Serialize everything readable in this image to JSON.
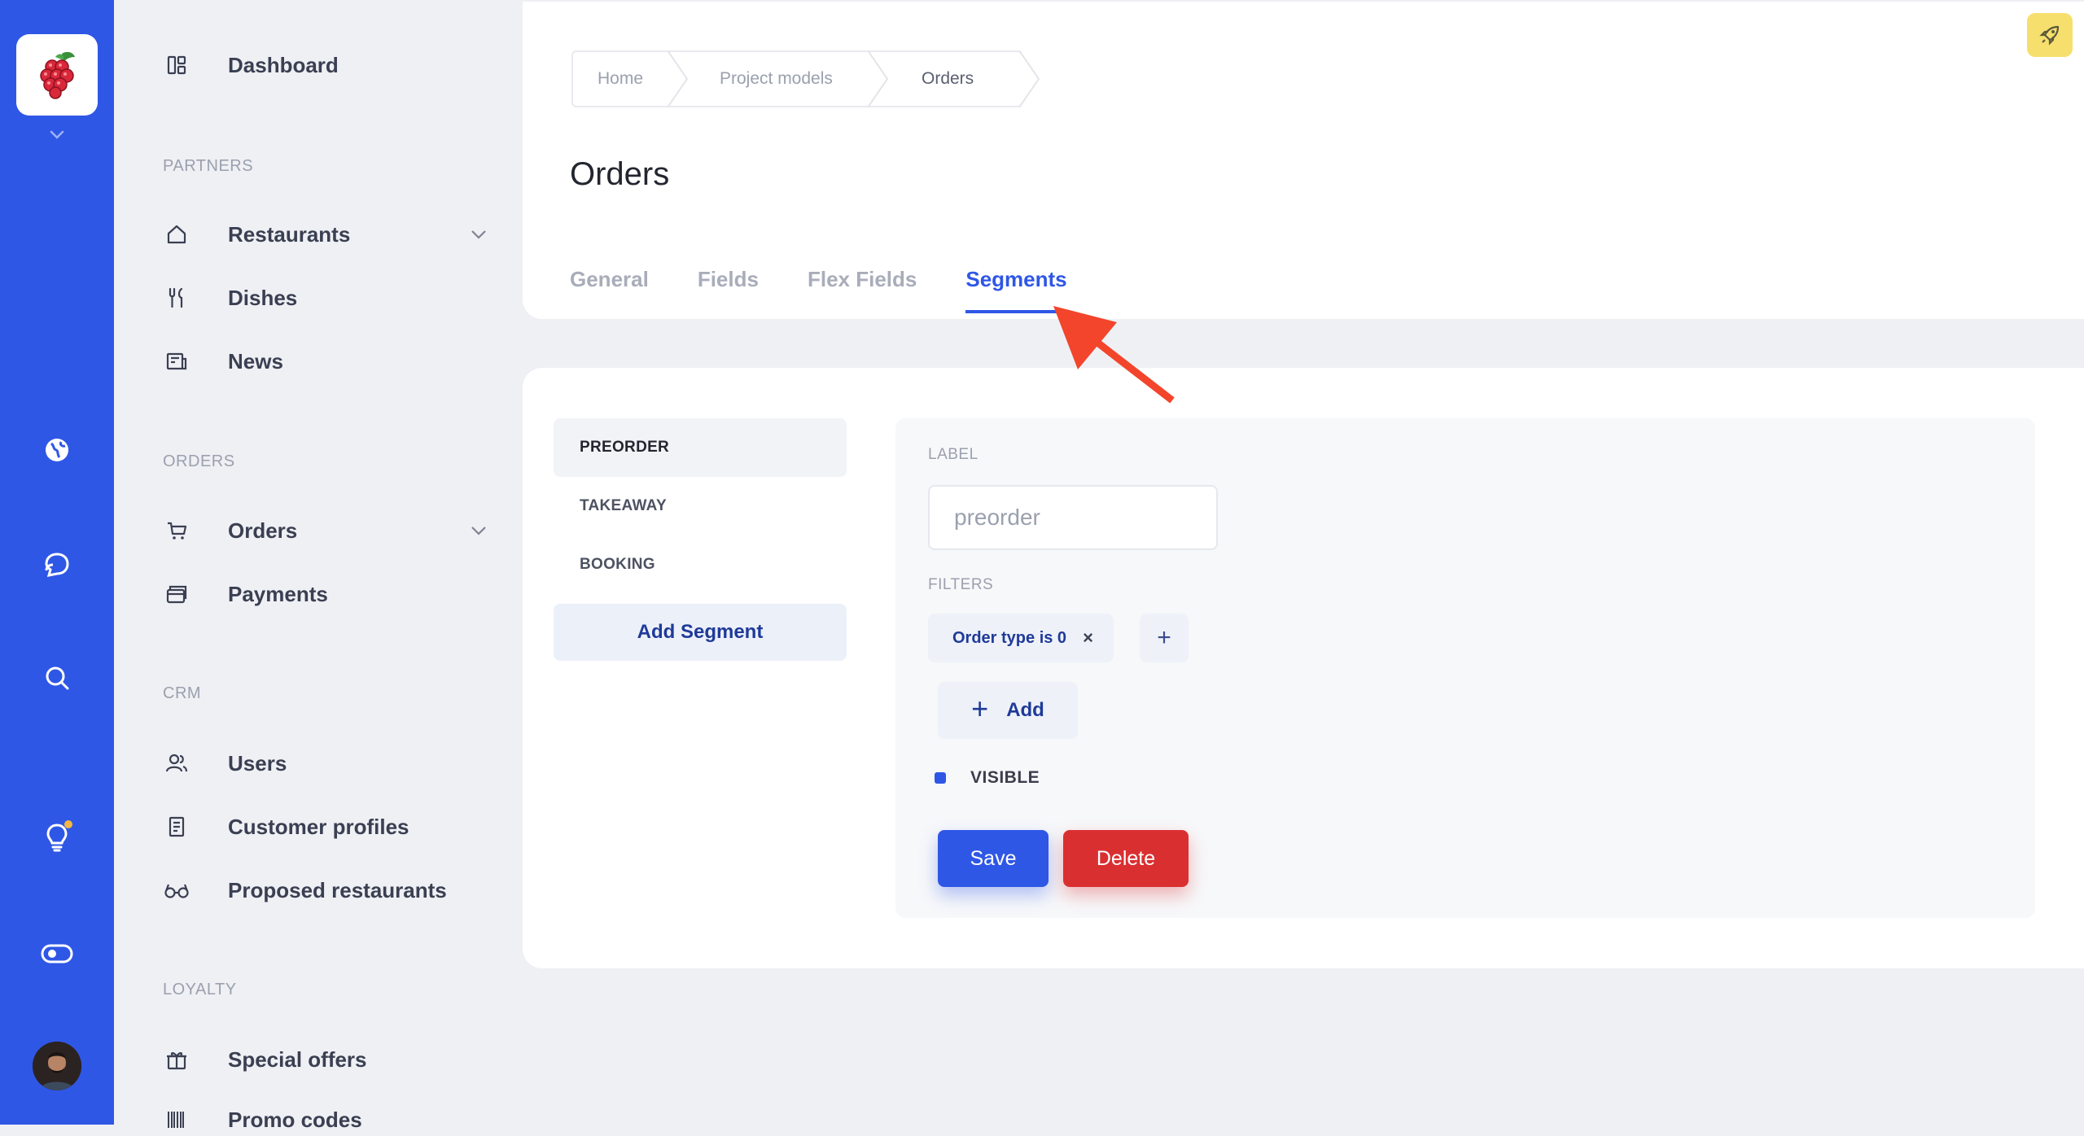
{
  "colors": {
    "accent": "#2f57e6",
    "danger": "#da2f31",
    "rail": "#2f57e6",
    "annotation_arrow": "#f2452c"
  },
  "rail": {
    "icons": [
      "app-logo-icon",
      "chevron-down-icon",
      "globe-icon",
      "chat-icon",
      "search-icon",
      "lightbulb-icon",
      "toggle-icon",
      "user-avatar"
    ]
  },
  "sidebar": {
    "dashboard": "Dashboard",
    "sections": {
      "partners": "PARTNERS",
      "orders": "ORDERS",
      "crm": "CRM",
      "loyalty": "LOYALTY"
    },
    "items": {
      "restaurants": "Restaurants",
      "dishes": "Dishes",
      "news": "News",
      "orders": "Orders",
      "payments": "Payments",
      "users": "Users",
      "customer_profiles": "Customer profiles",
      "proposed_restaurants": "Proposed restaurants",
      "special_offers": "Special offers",
      "promo_codes": "Promo codes"
    }
  },
  "breadcrumb": {
    "home": "Home",
    "project_models": "Project models",
    "orders": "Orders"
  },
  "page": {
    "title": "Orders",
    "tabs": [
      "General",
      "Fields",
      "Flex Fields",
      "Segments"
    ],
    "active_tab": "Segments"
  },
  "segments": {
    "items": [
      "PREORDER",
      "TAKEAWAY",
      "BOOKING"
    ],
    "selected": "PREORDER",
    "add_label": "Add Segment"
  },
  "form": {
    "label_heading": "LABEL",
    "label_value": "preorder",
    "filters_heading": "FILTERS",
    "filter_chip": "Order type is 0",
    "chip_remove": "×",
    "plus": "+",
    "add_label": "Add",
    "add_plus": "+",
    "visible_label": "VISIBLE",
    "save_label": "Save",
    "delete_label": "Delete"
  }
}
